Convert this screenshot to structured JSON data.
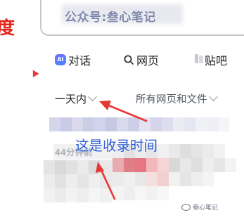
{
  "brand": {
    "logo_fragment": "度",
    "logo_color": "#e1251b"
  },
  "search": {
    "query": "公众号:叁心笔记"
  },
  "tabs": [
    {
      "label": "对话",
      "icon": "ai-chat-icon"
    },
    {
      "label": "网页",
      "icon": "search-icon"
    },
    {
      "label": "贴吧",
      "icon": "tieba-icon"
    }
  ],
  "filters": {
    "time_label": "一天内",
    "scope_label": "所有网页和文件"
  },
  "result": {
    "timestamp": "44分钟前"
  },
  "annotation": {
    "text": "这是收录时间",
    "color": "#2e5cd6",
    "arrow_color": "#e53935"
  },
  "watermark": {
    "text": "叁心笔记"
  }
}
